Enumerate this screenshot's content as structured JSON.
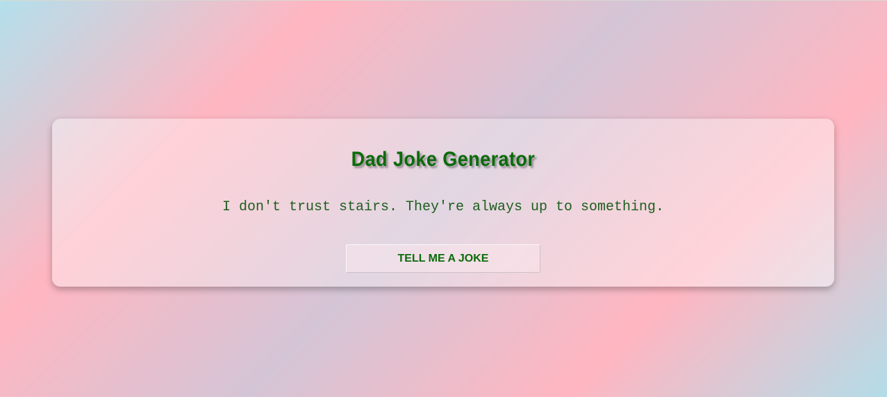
{
  "app": {
    "title": "Dad Joke Generator",
    "joke_text": "I don't trust stairs. They're always up to something.",
    "button_label": "TELL ME A JOKE"
  },
  "colors": {
    "title": "#0a6b0a",
    "joke_text": "#1d5e1d",
    "button_text": "#0a6b0a"
  }
}
